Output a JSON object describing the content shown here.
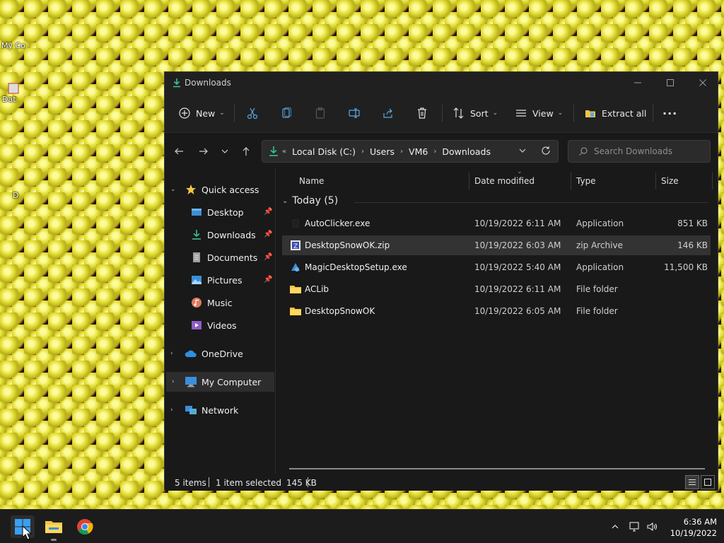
{
  "desktop": {
    "icons": [
      {
        "label": "My Co"
      },
      {
        "label": "Dat"
      },
      {
        "label": "D"
      }
    ]
  },
  "window": {
    "title": "Downloads",
    "controls": {
      "minimize": "—",
      "maximize": "☐",
      "close": "✕"
    }
  },
  "toolbar": {
    "new_label": "New",
    "sort_label": "Sort",
    "view_label": "View",
    "extract_label": "Extract all",
    "more_label": "···"
  },
  "address": {
    "crumbs": [
      "Local Disk (C:)",
      "Users",
      "VM6",
      "Downloads"
    ],
    "search_placeholder": "Search Downloads"
  },
  "nav": {
    "quick_access": "Quick access",
    "items": [
      {
        "label": "Desktop",
        "icon": "desktop-icon",
        "pinned": true
      },
      {
        "label": "Downloads",
        "icon": "downloads-icon",
        "pinned": true
      },
      {
        "label": "Documents",
        "icon": "documents-icon",
        "pinned": true
      },
      {
        "label": "Pictures",
        "icon": "pictures-icon",
        "pinned": true
      },
      {
        "label": "Music",
        "icon": "music-icon",
        "pinned": false
      },
      {
        "label": "Videos",
        "icon": "videos-icon",
        "pinned": false
      }
    ],
    "onedrive": "OneDrive",
    "my_computer": "My Computer",
    "network": "Network"
  },
  "content": {
    "columns": {
      "name": "Name",
      "date": "Date modified",
      "type": "Type",
      "size": "Size"
    },
    "group": "Today (5)",
    "files": [
      {
        "name": "AutoClicker.exe",
        "date": "10/19/2022 6:11 AM",
        "type": "Application",
        "size": "851 KB",
        "icon": "exe-icon"
      },
      {
        "name": "DesktopSnowOK.zip",
        "date": "10/19/2022 6:03 AM",
        "type": "zip Archive",
        "size": "146 KB",
        "icon": "zip-icon",
        "selected": true
      },
      {
        "name": "MagicDesktopSetup.exe",
        "date": "10/19/2022 5:40 AM",
        "type": "Application",
        "size": "11,500 KB",
        "icon": "setup-icon"
      },
      {
        "name": "ACLib",
        "date": "10/19/2022 6:11 AM",
        "type": "File folder",
        "size": "",
        "icon": "folder-icon"
      },
      {
        "name": "DesktopSnowOK",
        "date": "10/19/2022 6:05 AM",
        "type": "File folder",
        "size": "",
        "icon": "folder-icon"
      }
    ]
  },
  "status": {
    "items": "5 items",
    "selected": "1 item selected",
    "size": "145 KB"
  },
  "taskbar": {
    "time": "6:36 AM",
    "date": "10/19/2022"
  },
  "colors": {
    "accent": "#0078d4",
    "folder": "#f4c542",
    "download_green": "#3ac28a"
  }
}
